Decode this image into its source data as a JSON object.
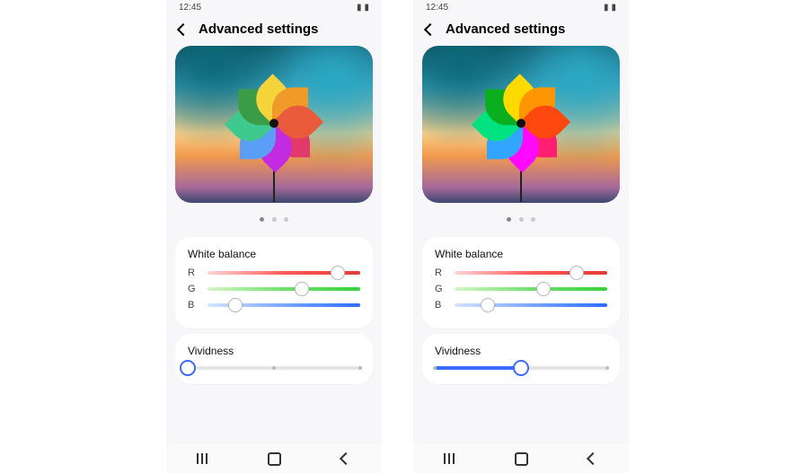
{
  "status_time": "12:45",
  "page_title": "Advanced settings",
  "pager": {
    "count": 3,
    "active": 0
  },
  "pinwheel": {
    "colors": [
      "#e23b6b",
      "#c22be0",
      "#5a9ef5",
      "#3fc98e",
      "#3a9c46",
      "#f5d33a",
      "#f09a2a",
      "#e95b3a"
    ]
  },
  "left": {
    "white_balance": {
      "title": "White balance",
      "r": {
        "label": "R",
        "pct": 85
      },
      "g": {
        "label": "G",
        "pct": 62
      },
      "b": {
        "label": "B",
        "pct": 18
      }
    },
    "vividness": {
      "title": "Vividness",
      "pct": 0,
      "ticks": [
        0,
        50,
        100
      ]
    }
  },
  "right": {
    "white_balance": {
      "title": "White balance",
      "r": {
        "label": "R",
        "pct": 80
      },
      "g": {
        "label": "G",
        "pct": 58
      },
      "b": {
        "label": "B",
        "pct": 22
      }
    },
    "vividness": {
      "title": "Vividness",
      "pct": 50,
      "ticks": [
        0,
        50,
        100
      ]
    }
  }
}
